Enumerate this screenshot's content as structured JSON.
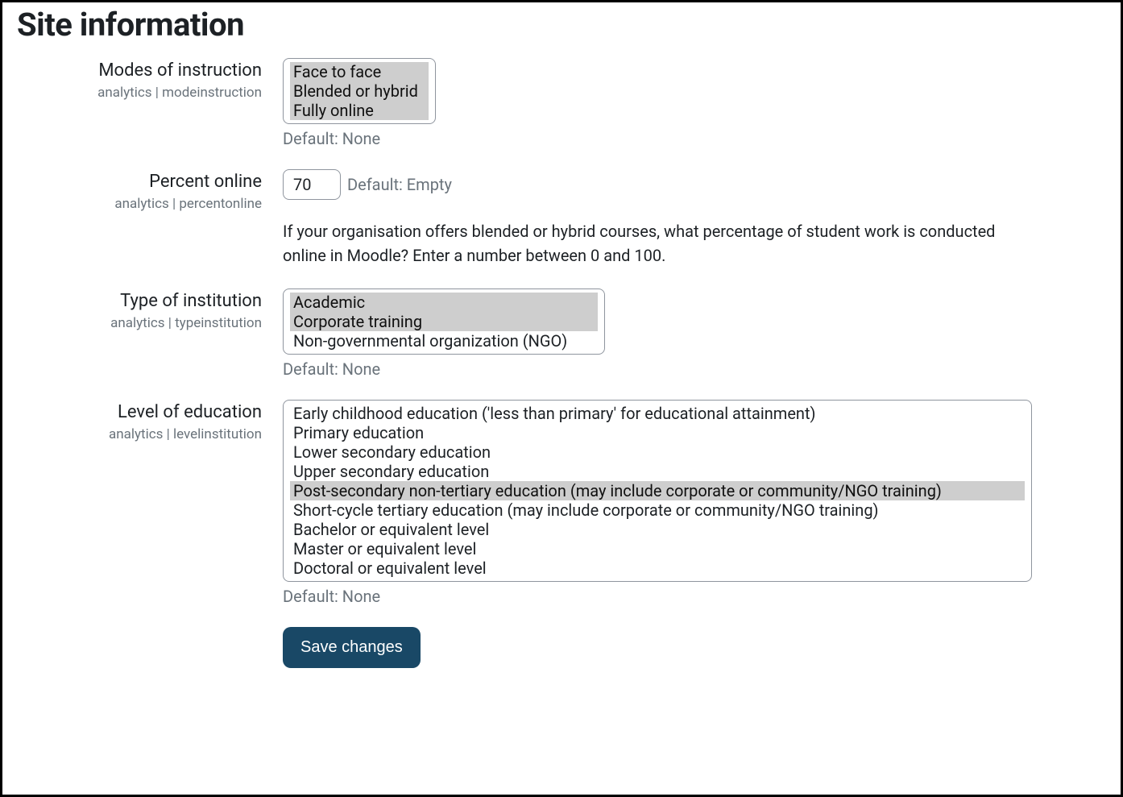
{
  "page": {
    "title": "Site information"
  },
  "fields": {
    "modes": {
      "label": "Modes of instruction",
      "setting_key": "analytics | modeinstruction",
      "options": [
        "Face to face",
        "Blended or hybrid",
        "Fully online"
      ],
      "selected": [
        "Face to face",
        "Blended or hybrid",
        "Fully online"
      ],
      "default_hint": "Default: None"
    },
    "percent": {
      "label": "Percent online",
      "setting_key": "analytics | percentonline",
      "value": "70",
      "default_hint": "Default: Empty",
      "description": "If your organisation offers blended or hybrid courses, what percentage of student work is conducted online in Moodle? Enter a number between 0 and 100."
    },
    "type": {
      "label": "Type of institution",
      "setting_key": "analytics | typeinstitution",
      "options": [
        "Academic",
        "Corporate training",
        "Non-governmental organization (NGO)"
      ],
      "selected": [
        "Academic",
        "Corporate training"
      ],
      "default_hint": "Default: None"
    },
    "level": {
      "label": "Level of education",
      "setting_key": "analytics | levelinstitution",
      "options": [
        "Early childhood education ('less than primary' for educational attainment)",
        "Primary education",
        "Lower secondary education",
        "Upper secondary education",
        "Post-secondary non-tertiary education (may include corporate or community/NGO training)",
        "Short-cycle tertiary education (may include corporate or community/NGO training)",
        "Bachelor or equivalent level",
        "Master or equivalent level",
        "Doctoral or equivalent level"
      ],
      "selected": [
        "Post-secondary non-tertiary education (may include corporate or community/NGO training)"
      ],
      "default_hint": "Default: None"
    }
  },
  "actions": {
    "save_label": "Save changes"
  }
}
